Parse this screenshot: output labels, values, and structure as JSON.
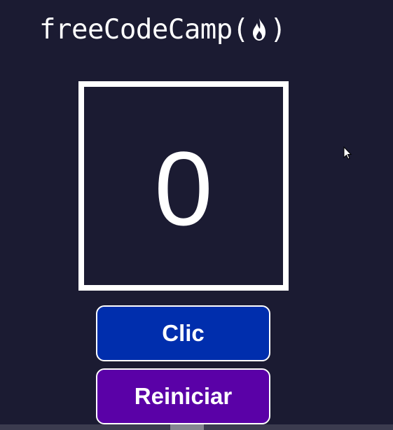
{
  "header": {
    "logo_text": "freeCodeCamp",
    "logo_open_paren": "(",
    "logo_close_paren": ")",
    "logo_icon": "flame-icon"
  },
  "counter": {
    "value": "0"
  },
  "buttons": {
    "click_label": "Clic",
    "reset_label": "Reiniciar"
  },
  "colors": {
    "background": "#1b1b32",
    "click_button": "#002ead",
    "reset_button": "#5a01a7",
    "text": "#ffffff"
  }
}
